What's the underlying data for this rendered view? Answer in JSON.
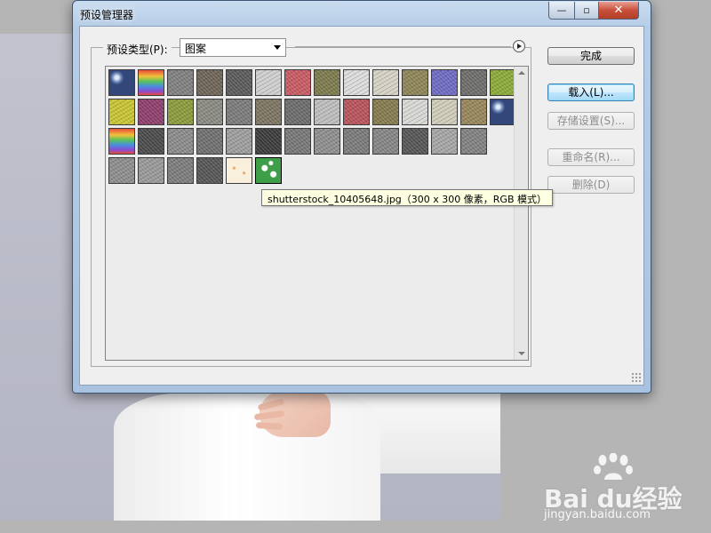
{
  "dialog": {
    "title": "预设管理器",
    "close_glyph": "✕",
    "maximize_glyph": "▫",
    "minimize_glyph": "—"
  },
  "preset_type": {
    "label": "预设类型(P):",
    "selected": "图案"
  },
  "buttons": {
    "done": "完成",
    "load": "载入(L)...",
    "save": "存储设置(S)...",
    "rename": "重命名(R)...",
    "delete": "删除(D)"
  },
  "tooltip": {
    "text": "shutterstock_10405648.jpg（300 x 300 像素，RGB 模式）"
  },
  "swatches": [
    [
      "bubbles-blue",
      "rainbow-wave",
      "gravel-gray",
      "pebbles-brown",
      "granite-dark",
      "speckle-light",
      "flowers-red",
      "moss-olive",
      "paper-white",
      "paper-cream",
      "grass-dry",
      "flowers-purple",
      "leaves-gray",
      "leaves-green"
    ],
    [
      "yellow-dots",
      "flowers-magenta",
      "lichen-green",
      "stone-gray",
      "granite-gray",
      "rocks-brown",
      "asphalt-gray",
      "speckle-white",
      "flowers-red2",
      "moss-brown",
      "paper-light",
      "paper-beige",
      "grass-brown",
      "bubbles-blue2"
    ],
    [
      "rainbow-wave2",
      "noise-dark",
      "noise-light",
      "noise-medium",
      "noise-soft",
      "noise-black",
      "noise-gray",
      "noise-sparse",
      "noise-fine",
      "noise-streak",
      "noise-deep",
      "noise-pale",
      "noise-mid"
    ],
    [
      "noise-scratch",
      "noise-fiber",
      "noise-grain",
      "noise-harsh",
      "cream-floral",
      "green-floral"
    ]
  ],
  "watermark": {
    "logo": "Bai du经验",
    "url": "jingyan.baidu.com"
  }
}
